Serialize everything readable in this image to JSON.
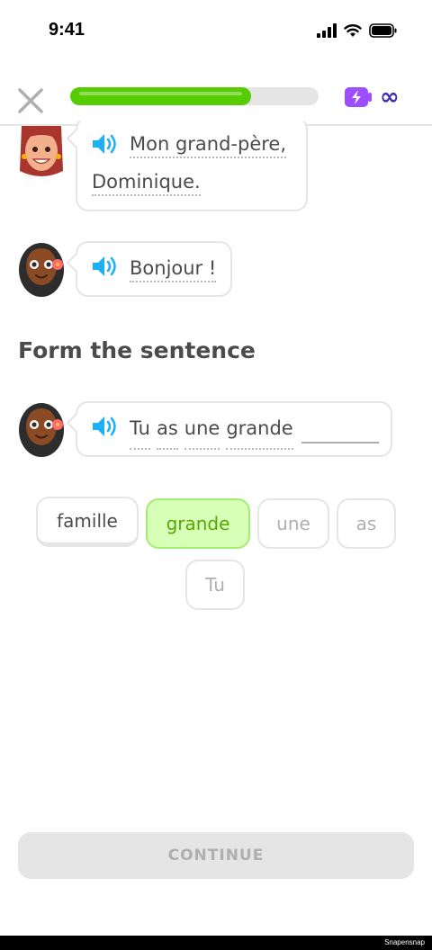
{
  "status_bar": {
    "time": "9:41"
  },
  "header": {
    "progress_percent": 73,
    "energy": "∞"
  },
  "conversation": [
    {
      "speaker": "woman",
      "lines": [
        "Mon grand-père,",
        "Dominique."
      ]
    },
    {
      "speaker": "girl",
      "lines": [
        "Bonjour !"
      ]
    }
  ],
  "prompt": {
    "title": "Form the sentence"
  },
  "answer": {
    "words": [
      "Tu",
      "as",
      "une",
      "grande"
    ]
  },
  "word_bank": [
    {
      "label": "famille",
      "state": "available"
    },
    {
      "label": "grande",
      "state": "selected"
    },
    {
      "label": "une",
      "state": "used"
    },
    {
      "label": "as",
      "state": "used"
    },
    {
      "label": "Tu",
      "state": "used"
    }
  ],
  "footer": {
    "continue_label": "CONTINUE",
    "watermark": "Snapensnap"
  },
  "colors": {
    "progress": "#58cc02",
    "selected_chip_bg": "#d7ffb8",
    "selected_chip_text": "#58a700",
    "speaker_blue": "#1cb0f6",
    "energy_purple": "#9b4dff",
    "infinity_blue": "#3c2cb8"
  }
}
